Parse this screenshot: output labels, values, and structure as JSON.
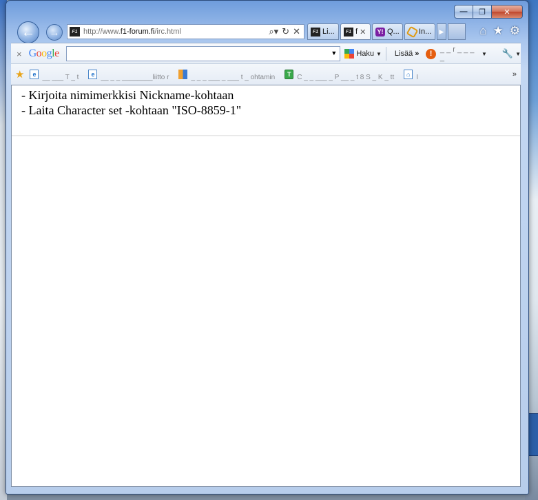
{
  "window": {
    "controls": {
      "minimize": "—",
      "maximize": "❐",
      "close": "✕"
    }
  },
  "address_bar": {
    "url_prefix": "http://www.",
    "url_domain": "f1-forum.fi",
    "url_path": "/irc.html",
    "favicon_text": "F1"
  },
  "tabs": [
    {
      "label": "Li...",
      "icon": "f1-favicon"
    },
    {
      "label": "f",
      "icon": "f1-favicon",
      "active": true,
      "close": "✕"
    },
    {
      "label": "Q...",
      "icon": "yahoo-favicon",
      "favicon_text": "Y!"
    },
    {
      "label": "In...",
      "icon": "hexagon-favicon"
    }
  ],
  "toolbar": {
    "close": "×",
    "google_logo": "Google",
    "search_value": "",
    "search_label": "Haku",
    "more_label": "Lisää",
    "more_arrows": "»",
    "account_label": "_ _ r _ _ _ _"
  },
  "favorites": [
    {
      "icon": "ie-page-icon",
      "label": "__ ___ T  _ t"
    },
    {
      "icon": "ie-page-icon",
      "label": "__ _ _ ________liitto r"
    },
    {
      "icon": "bookmark-icon",
      "label": "_ _ _ ___ _ ___ t  _ ohtamin"
    },
    {
      "icon": "t-site-icon",
      "label": "C _ _ ___ _ P __ _ t  8 S _ K _ tt"
    },
    {
      "icon": "home-page-icon",
      "label": "I"
    }
  ],
  "page": {
    "lines": [
      "- Kirjoita nimimerkkisi Nickname-kohtaan",
      "- Laita Character set -kohtaan \"ISO-8859-1\""
    ]
  }
}
